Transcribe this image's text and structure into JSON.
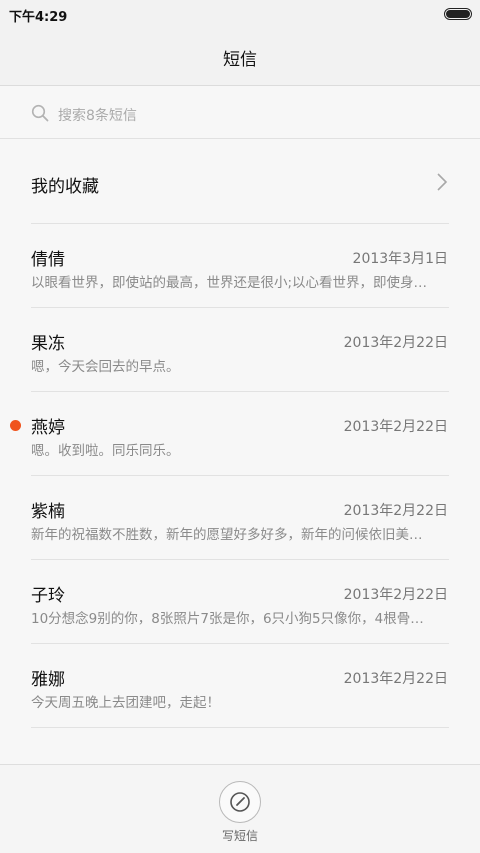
{
  "status_bar": {
    "time": "下午4:29"
  },
  "header": {
    "title": "短信"
  },
  "search": {
    "placeholder": "搜索8条短信"
  },
  "favorites": {
    "label": "我的收藏"
  },
  "conversations": [
    {
      "name": "倩倩",
      "date": "2013年3月1日",
      "preview": "以眼看世界，即使站的最高，世界还是很小;以心看世界，即使身…",
      "unread": false
    },
    {
      "name": "果冻",
      "date": "2013年2月22日",
      "preview": "嗯，今天会回去的早点。",
      "unread": false
    },
    {
      "name": "燕婷",
      "date": "2013年2月22日",
      "preview": "嗯。收到啦。同乐同乐。",
      "unread": true
    },
    {
      "name": "紫楠",
      "date": "2013年2月22日",
      "preview": "新年的祝福数不胜数，新年的愿望好多好多，新年的问候依旧美…",
      "unread": false
    },
    {
      "name": "子玲",
      "date": "2013年2月22日",
      "preview": "10分想念9别的你，8张照片7张是你，6只小狗5只像你，4根骨…",
      "unread": false
    },
    {
      "name": "雅娜",
      "date": "2013年2月22日",
      "preview": "今天周五晚上去团建吧，走起！",
      "unread": false
    }
  ],
  "compose": {
    "label": "写短信"
  },
  "colors": {
    "unread_dot": "#f0531c",
    "background": "#f7f7f7"
  },
  "icons": {
    "search": "search-icon",
    "chevron": "chevron-right-icon",
    "compose": "compose-icon",
    "battery": "battery-icon"
  }
}
